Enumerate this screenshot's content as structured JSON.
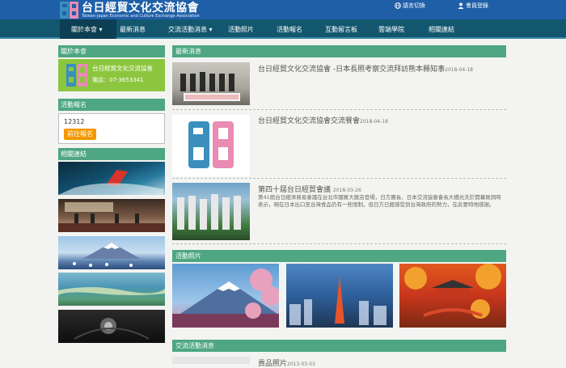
{
  "header": {
    "title": "台日經貿文化交流協會",
    "subtitle": "Taiwan-Japan Economic and Culture Exchange Association",
    "language_label": "語言切換",
    "login_label": "會員登錄"
  },
  "nav": [
    {
      "label": "關於本會"
    },
    {
      "label": "最新消息"
    },
    {
      "label": "交流活動消息"
    },
    {
      "label": "活動照片"
    },
    {
      "label": "活動報名"
    },
    {
      "label": "互動留言板"
    },
    {
      "label": "雲端學院"
    },
    {
      "label": "相關連結"
    }
  ],
  "sidebar": {
    "about": {
      "heading": "關於本會",
      "name": "台日經貿文化交流協會",
      "phone": "電話：07-3653341"
    },
    "registration": {
      "heading": "活動報名",
      "value": "12312",
      "button_label": "前往報名"
    },
    "links": {
      "heading": "相關連結"
    }
  },
  "main": {
    "news_heading": "最新消息",
    "news": [
      {
        "title": "台日經貿文化交流協會 -日本長照考察交流拜訪熊本縣知事",
        "date": "2018-04-18"
      },
      {
        "title": "台日經貿文化交流協會交流餐會",
        "date": "2018-04-18"
      },
      {
        "title": "第四十屆台日經貿會議",
        "date": "2018-03-26",
        "description": "第41屆台日經濟貿易會議在台北市國賓大飯店登場，日方團長、日本交流協會會長大橋光夫於開幕致詞時表示，現在日本出口至台灣食品仍有一些限制，但日方已經感受到台灣政府的努力，在此要特地感謝。"
      }
    ],
    "photos_heading": "活動照片",
    "exchange_heading": "交流活動消息",
    "exchange_first": {
      "title": "貢品照片",
      "date": "2013-03-03"
    }
  },
  "colors": {
    "header_blue": "#1f5fa8",
    "nav_teal": "#13576f",
    "section_green": "#4ea782",
    "about_green": "#8cc63f",
    "button_orange": "#f39800"
  }
}
